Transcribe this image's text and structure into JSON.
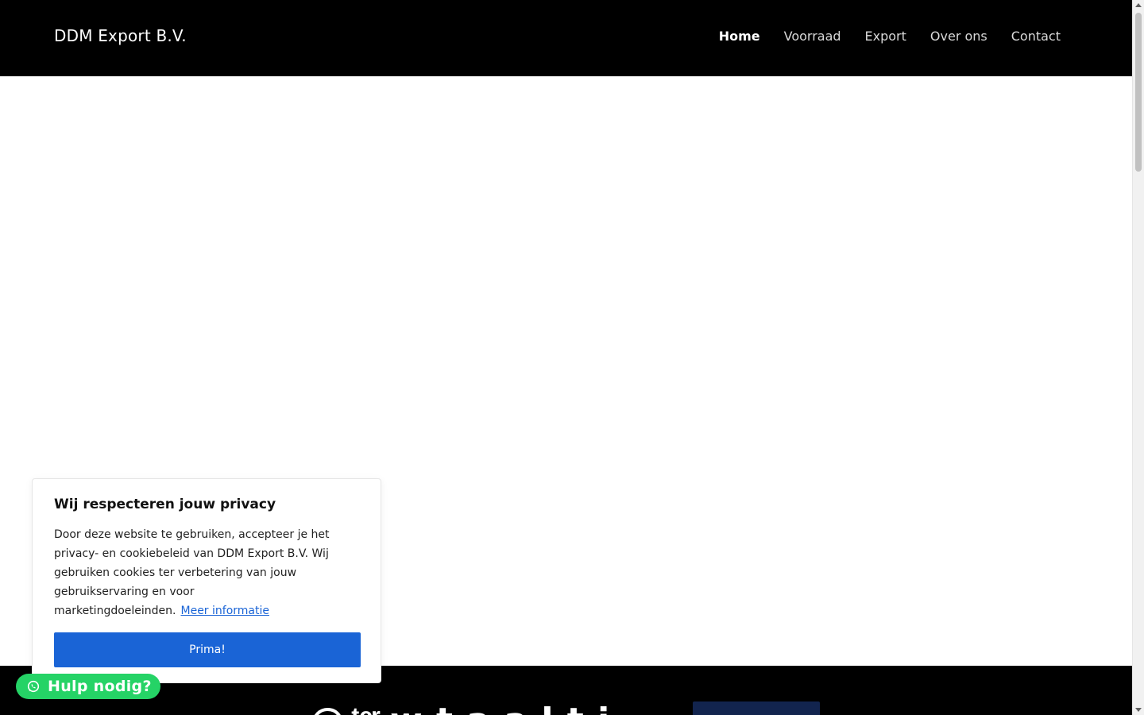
{
  "header": {
    "brand": "DDM Export B.V.",
    "nav": [
      {
        "label": "Home",
        "active": true
      },
      {
        "label": "Voorraad",
        "active": false
      },
      {
        "label": "Export",
        "active": false
      },
      {
        "label": "Over ons",
        "active": false
      },
      {
        "label": "Contact",
        "active": false
      }
    ]
  },
  "band": {
    "headline": "@ ͭ ͨ ͬ  w  t  a  a l  t i"
  },
  "cookie": {
    "title": "Wij respecteren jouw privacy",
    "body": "Door deze website te gebruiken, accepteer je het privacy- en cookiebeleid van DDM Export B.V. Wij gebruiken cookies ter verbetering van jouw gebruikservaring en voor marketingdoeleinden.",
    "link": "Meer informatie",
    "button": "Prima!"
  },
  "help": {
    "label": "Hulp nodig?",
    "icon": "whatsapp-icon"
  },
  "colors": {
    "header_bg": "#000000",
    "cookie_button": "#1a64d6",
    "help_bg": "#25d366",
    "cta_bg": "#12244e"
  }
}
